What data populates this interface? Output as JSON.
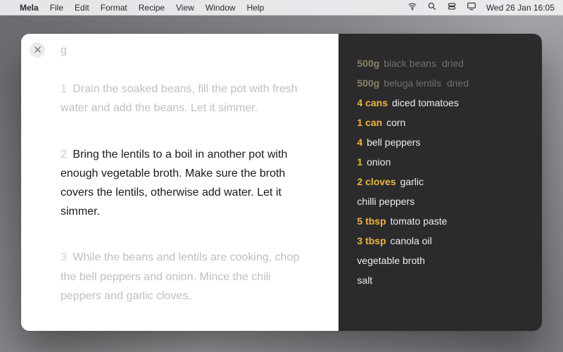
{
  "menubar": {
    "app": "Mela",
    "items": [
      "File",
      "Edit",
      "Format",
      "Recipe",
      "View",
      "Window",
      "Help"
    ],
    "clock": "Wed 26 Jan  16:05"
  },
  "overflow_top": "g",
  "steps": [
    {
      "num": "1",
      "text": "Drain the soaked beans, fill the pot with fresh water and add the beans. Let it simmer.",
      "active": false
    },
    {
      "num": "2",
      "text": "Bring the lentils to a boil in another pot with enough vegetable broth. Make sure the broth covers the lentils, otherwise add water. Let it simmer.",
      "active": true
    },
    {
      "num": "3",
      "text": "While the beans and lentils are cooking, chop the bell peppers and onion. Mince the chili peppers and garlic cloves.",
      "active": false
    }
  ],
  "ingredients": [
    {
      "qty": "500g",
      "name": "black beans",
      "note": "dried",
      "dim": true
    },
    {
      "qty": "500g",
      "name": "beluga lentils",
      "note": "dried",
      "dim": true
    },
    {
      "qty": "4 cans",
      "name": "diced tomatoes",
      "dim": false
    },
    {
      "qty": "1 can",
      "name": "corn",
      "dim": false
    },
    {
      "qty": "4",
      "name": "bell peppers",
      "dim": false
    },
    {
      "qty": "1",
      "name": "onion",
      "dim": false
    },
    {
      "qty": "2 cloves",
      "name": "garlic",
      "dim": false
    },
    {
      "qty": "",
      "name": "chilli peppers",
      "dim": false
    },
    {
      "qty": "5 tbsp",
      "name": "tomato paste",
      "dim": false
    },
    {
      "qty": "3 tbsp",
      "name": "canola oil",
      "dim": false
    },
    {
      "qty": "",
      "name": "vegetable broth",
      "dim": true
    },
    {
      "qty": "",
      "name": "salt",
      "dim": false
    }
  ]
}
